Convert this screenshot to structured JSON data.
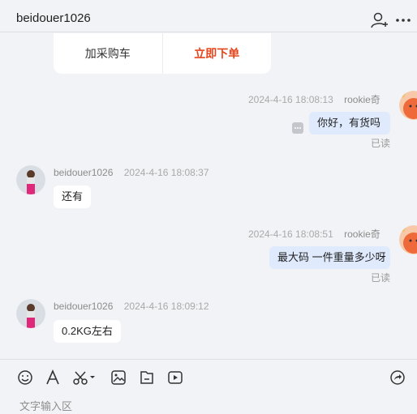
{
  "header": {
    "title": "beidouer1026",
    "icons": [
      "add-contact-icon",
      "more-icon"
    ]
  },
  "order_card": {
    "add_to_cart": "加采购车",
    "buy_now": "立即下单"
  },
  "messages": [
    {
      "direction": "out",
      "sender": "rookie奇",
      "time": "2024-4-16 18:08:13",
      "text": "你好，有货吗",
      "status": "已读"
    },
    {
      "direction": "in",
      "sender": "beidouer1026",
      "time": "2024-4-16 18:08:37",
      "text": "还有"
    },
    {
      "direction": "out",
      "sender": "rookie奇",
      "time": "2024-4-16 18:08:51",
      "text": "最大码 一件重量多少呀",
      "status": "已读"
    },
    {
      "direction": "in",
      "sender": "beidouer1026",
      "time": "2024-4-16 18:09:12",
      "text": "0.2KG左右"
    }
  ],
  "toolbar": {
    "icons": [
      "emoji-icon",
      "font-icon",
      "scissors-icon",
      "image-icon",
      "file-icon",
      "video-icon",
      "share-icon"
    ],
    "input_placeholder": "文字输入区"
  },
  "colors": {
    "accent": "#e5451c",
    "out_bubble": "#dfeafd",
    "background": "#f2f3f6"
  }
}
